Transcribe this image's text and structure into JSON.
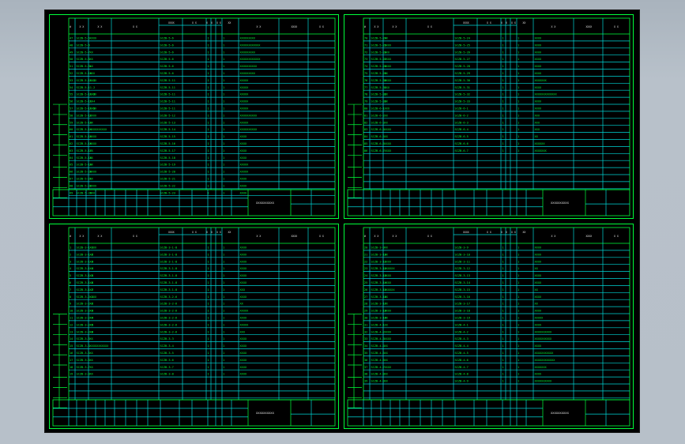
{
  "sheets": [
    {
      "id": "sheet-1",
      "title": "XXXXXXXXXX",
      "rows": [
        {
          "no": "47",
          "code": "SCZB-5-5",
          "name": "XXXX",
          "dwg": "SCZB-5-6",
          "note": "XXXXXXXXX"
        },
        {
          "no": "48",
          "code": "SCZB-5-6",
          "name": "",
          "dwg": "SCZB-5-6",
          "note": "XXXXXXXXXXXX"
        },
        {
          "no": "49",
          "code": "SCZB-5-7",
          "name": "XX",
          "dwg": "SCZB-5-6",
          "note": "XXXXXXXXX"
        },
        {
          "no": "50",
          "code": "SCZB-5-8",
          "name": "XX",
          "dwg": "SCZB-5-6",
          "note": "XXXXXXXXXXXX"
        },
        {
          "no": "51",
          "code": "SCZB-5-9L",
          "name": "XX",
          "dwg": "SCZB-5-6",
          "note": "XXXXXXXXXX"
        },
        {
          "no": "52",
          "code": "SCZB-5-10",
          "name": "XXX",
          "dwg": "SCZB-5-6",
          "note": "XXXXXXXXX"
        },
        {
          "no": "53",
          "code": "SCZB-5-11-1",
          "name": "XXXX",
          "dwg": "SCZB-5-11",
          "note": "XXXXX"
        },
        {
          "no": "54",
          "code": "SCZB-5-11-2",
          "name": "",
          "dwg": "SCZB-5-11",
          "note": "XXXXX"
        },
        {
          "no": "55",
          "code": "SCZB-5-11-3",
          "name": "XXXX",
          "dwg": "SCZB-5-11",
          "note": "XXXXX"
        },
        {
          "no": "56",
          "code": "SCZB-5-11-4",
          "name": "XX",
          "dwg": "SCZB-5-11",
          "note": "XXXXX"
        },
        {
          "no": "57",
          "code": "SCZB-5-11-5",
          "name": "XXXX",
          "dwg": "SCZB-5-11",
          "note": "XXXXX"
        },
        {
          "no": "58",
          "code": "SCZB-5-12",
          "name": "XXXX",
          "dwg": "SCZB-5-12",
          "note": "XXXXXXXXXX"
        },
        {
          "no": "59",
          "code": "SCZB-5-13",
          "name": "XX",
          "dwg": "SCZB-5-13",
          "note": "XXXXX"
        },
        {
          "no": "60",
          "code": "SCZB-5-14",
          "name": "XXXXXXXXXX",
          "dwg": "SCZB-5-14",
          "note": "XXXXXXXXXX"
        },
        {
          "no": "61",
          "code": "SCZB-5-15",
          "name": "XXXX",
          "dwg": "SCZB-5-15",
          "note": "XXXX"
        },
        {
          "no": "62",
          "code": "SCZB-5-16",
          "name": "XXXX",
          "dwg": "SCZB-5-16",
          "note": "XXXX"
        },
        {
          "no": "63",
          "code": "SCZB-5-17",
          "name": "XX",
          "dwg": "SCZB-5-17",
          "note": "XXXX"
        },
        {
          "no": "64",
          "code": "SCZB-5-18",
          "name": "XX",
          "dwg": "SCZB-5-18",
          "note": "XXXX"
        },
        {
          "no": "65",
          "code": "SCZB-5-19",
          "name": "XX",
          "dwg": "SCZB-5-19",
          "note": "XXXXX"
        },
        {
          "no": "66",
          "code": "SCZB-5-20",
          "name": "XXXX",
          "dwg": "SCZB-5-20",
          "note": "XXXXX"
        },
        {
          "no": "67",
          "code": "SCZB-5-21",
          "name": "XX",
          "dwg": "SCZB-5-21",
          "note": "XXXX"
        },
        {
          "no": "68",
          "code": "SCZB-5-22",
          "name": "XXXX",
          "dwg": "SCZB-5-22",
          "note": "XXXX"
        },
        {
          "no": "69",
          "code": "SCZB-5-23",
          "name": "XXX",
          "dwg": "SCZB-5-23",
          "note": "XXXX"
        }
      ]
    },
    {
      "id": "sheet-2",
      "title": "XXXXXXXXXX",
      "rows": [
        {
          "no": "70",
          "code": "SCZB-5-24",
          "name": "XX",
          "dwg": "SCZB-5-24",
          "note": "XXXX"
        },
        {
          "no": "71",
          "code": "SCZB-5-25",
          "name": "XXXX",
          "dwg": "SCZB-5-25",
          "note": "XXXX"
        },
        {
          "no": "72",
          "code": "SCZB-5-26",
          "name": "XXX",
          "dwg": "SCZB-5-26",
          "note": "XXXX"
        },
        {
          "no": "73",
          "code": "SCZB-5-27",
          "name": "XXXX",
          "dwg": "SCZB-5-27",
          "note": "XXXX"
        },
        {
          "no": "74",
          "code": "SCZB-5-28",
          "name": "XXXX",
          "dwg": "SCZB-5-28",
          "note": "XXXX"
        },
        {
          "no": "75",
          "code": "SCZB-5-29",
          "name": "XX",
          "dwg": "SCZB-5-29",
          "note": "XXXX"
        },
        {
          "no": "76",
          "code": "SCZB-5-30",
          "name": "XXXX",
          "dwg": "SCZB-5-30",
          "note": "XXXXXXX"
        },
        {
          "no": "77",
          "code": "SCZB-5-31",
          "name": "XXX",
          "dwg": "SCZB-5-31",
          "note": "XXXX"
        },
        {
          "no": "78",
          "code": "SCZB-5-32",
          "name": "XX",
          "dwg": "SCZB-5-32",
          "note": "XXXXXXXXXXXXX"
        },
        {
          "no": "79",
          "code": "SCZB-5-33",
          "name": "XX",
          "dwg": "SCZB-5-33",
          "note": "XXXX"
        },
        {
          "no": "80",
          "code": "SCZB-6-1",
          "name": "XXX",
          "dwg": "SCZB-6-1",
          "note": "XXXX"
        },
        {
          "no": "81",
          "code": "SCZB-6-2",
          "name": "XX",
          "dwg": "SCZB-6-2",
          "note": "XXX"
        },
        {
          "no": "82",
          "code": "SCZB-6-3",
          "name": "XX",
          "dwg": "SCZB-6-3",
          "note": "XXX"
        },
        {
          "no": "83",
          "code": "SCZB-6-4",
          "name": "XXXX",
          "dwg": "SCZB-6-4",
          "note": "XXX"
        },
        {
          "no": "84",
          "code": "SCZB-6-5",
          "name": "XX",
          "dwg": "SCZB-6-5",
          "note": "XX"
        },
        {
          "no": "85",
          "code": "SCZB-6-6",
          "name": "XXXX",
          "dwg": "SCZB-6-6",
          "note": "XXXXXX"
        },
        {
          "no": "86",
          "code": "SCZB-6-7",
          "name": "XXXX",
          "dwg": "SCZB-6-7",
          "note": "XXXXXXX"
        }
      ]
    },
    {
      "id": "sheet-3",
      "title": "XXXXXXXXXX",
      "rows": [
        {
          "no": "1",
          "code": "SCZB-3-1-1",
          "name": "XXXX",
          "dwg": "SCZB-3-1-8",
          "note": "XXXX"
        },
        {
          "no": "2",
          "code": "SCZB-3-1-2",
          "name": "XX",
          "dwg": "SCZB-3-1-8",
          "note": "XXXX"
        },
        {
          "no": "3",
          "code": "SCZB-3-1-3",
          "name": "XX",
          "dwg": "SCZB-3-1-8",
          "note": "XXXX"
        },
        {
          "no": "4",
          "code": "SCZB-3-1-4",
          "name": "XX",
          "dwg": "SCZB-3-1-8",
          "note": "XXXX"
        },
        {
          "no": "5",
          "code": "SCZB-3-1-5",
          "name": "XX",
          "dwg": "SCZB-3-1-8",
          "note": "XXXX"
        },
        {
          "no": "6",
          "code": "SCZB-3-1-6",
          "name": "XX",
          "dwg": "SCZB-3-1-8",
          "note": "XXXX"
        },
        {
          "no": "7",
          "code": "SCZB-3-1-7",
          "name": "XX",
          "dwg": "SCZB-3-1-8",
          "note": "XXX"
        },
        {
          "no": "8",
          "code": "SCZB-3-2-1",
          "name": "XXXX",
          "dwg": "SCZB-3-2-6",
          "note": "XXXX"
        },
        {
          "no": "9",
          "code": "SCZB-3-2-2",
          "name": "XX",
          "dwg": "SCZB-3-2-6",
          "note": "XX"
        },
        {
          "no": "10",
          "code": "SCZB-3-2-3",
          "name": "XX",
          "dwg": "SCZB-3-2-6",
          "note": "XXXXX"
        },
        {
          "no": "11",
          "code": "SCZB-3-2-4",
          "name": "XX",
          "dwg": "SCZB-3-2-6",
          "note": "XXXX"
        },
        {
          "no": "12",
          "code": "SCZB-3-2-5",
          "name": "XX",
          "dwg": "SCZB-3-2-6",
          "note": "XXXXX"
        },
        {
          "no": "13",
          "code": "SCZB-3-2-6",
          "name": "XX",
          "dwg": "SCZB-3-2-6",
          "note": "XXX"
        },
        {
          "no": "14",
          "code": "SCZB-3-3",
          "name": "XX",
          "dwg": "SCZB-3-3",
          "note": "XXXX"
        },
        {
          "no": "15",
          "code": "SCZB-3-4",
          "name": "XXXXXXXXXXX",
          "dwg": "SCZB-3-4",
          "note": "XXXX"
        },
        {
          "no": "16",
          "code": "SCZB-3-5",
          "name": "XX",
          "dwg": "SCZB-3-5",
          "note": "XXXX"
        },
        {
          "no": "17",
          "code": "SCZB-3-6",
          "name": "XX",
          "dwg": "SCZB-3-6",
          "note": "XXXX"
        },
        {
          "no": "18",
          "code": "SCZB-3-7",
          "name": "XX",
          "dwg": "SCZB-3-7",
          "note": "XXXX"
        },
        {
          "no": "19",
          "code": "SCZB-3-8",
          "name": "XX",
          "dwg": "SCZB-3-8",
          "note": "XXXX"
        }
      ]
    },
    {
      "id": "sheet-4",
      "title": "XXXXXXXXXX",
      "rows": [
        {
          "no": "20",
          "code": "SCZB-3-9",
          "name": "XX",
          "dwg": "SCZB-3-9",
          "note": "XXXX"
        },
        {
          "no": "21",
          "code": "SCZB-3-10",
          "name": "XX",
          "dwg": "SCZB-3-10",
          "note": "XXXX"
        },
        {
          "no": "22",
          "code": "SCZB-3-11",
          "name": "XXXX",
          "dwg": "SCZB-3-11",
          "note": "XXXX"
        },
        {
          "no": "23",
          "code": "SCZB-3-12",
          "name": "XXXXXX",
          "dwg": "SCZB-3-12",
          "note": "XX"
        },
        {
          "no": "24",
          "code": "SCZB-3-13",
          "name": "XXXX",
          "dwg": "SCZB-3-13",
          "note": "XXXX"
        },
        {
          "no": "25",
          "code": "SCZB-3-14",
          "name": "XXXX",
          "dwg": "SCZB-3-14",
          "note": "XXXX"
        },
        {
          "no": "26",
          "code": "SCZB-3-15",
          "name": "XXXXXX",
          "dwg": "SCZB-3-15",
          "note": "XX"
        },
        {
          "no": "27",
          "code": "SCZB-3-16",
          "name": "XX",
          "dwg": "SCZB-3-16",
          "note": "XXXX"
        },
        {
          "no": "28",
          "code": "SCZB-3-17",
          "name": "XX",
          "dwg": "SCZB-3-17",
          "note": "XX"
        },
        {
          "no": "29",
          "code": "SCZB-3-18",
          "name": "XXXX",
          "dwg": "SCZB-3-18",
          "note": "XXXX"
        },
        {
          "no": "30",
          "code": "SCZB-3-19",
          "name": "XX",
          "dwg": "SCZB-3-19",
          "note": "XXXXX"
        },
        {
          "no": "31",
          "code": "SCZB-4-1",
          "name": "XX",
          "dwg": "SCZB-4-1",
          "note": "XXXX"
        },
        {
          "no": "32",
          "code": "SCZB-4-2",
          "name": "XXXX",
          "dwg": "SCZB-4-2",
          "note": "XXXXXXXXXX"
        },
        {
          "no": "33",
          "code": "SCZB-4-3",
          "name": "XXXX",
          "dwg": "SCZB-4-3",
          "note": "XXXXXXXXXX"
        },
        {
          "no": "34",
          "code": "SCZB-4-4",
          "name": "XX",
          "dwg": "SCZB-4-4",
          "note": "XXXX"
        },
        {
          "no": "35",
          "code": "SCZB-4-5",
          "name": "XX",
          "dwg": "SCZB-4-5",
          "note": "XXXXXXXXXXX"
        },
        {
          "no": "36",
          "code": "SCZB-4-6",
          "name": "XX",
          "dwg": "SCZB-4-6",
          "note": "XXXXXXXXXXXX"
        },
        {
          "no": "37",
          "code": "SCZB-4-7",
          "name": "XXXX",
          "dwg": "SCZB-4-7",
          "note": "XXXXXXX"
        },
        {
          "no": "38",
          "code": "SCZB-4-8",
          "name": "XX",
          "dwg": "SCZB-4-8",
          "note": "XXXX"
        },
        {
          "no": "39",
          "code": "SCZB-4-9",
          "name": "XX",
          "dwg": "SCZB-4-9",
          "note": "XXXXXXXXXX"
        }
      ]
    }
  ],
  "colors": {
    "frame": "#00ff3a",
    "grid": "#00d6d6",
    "background": "#000000",
    "desktop": "#b7c0c9"
  }
}
